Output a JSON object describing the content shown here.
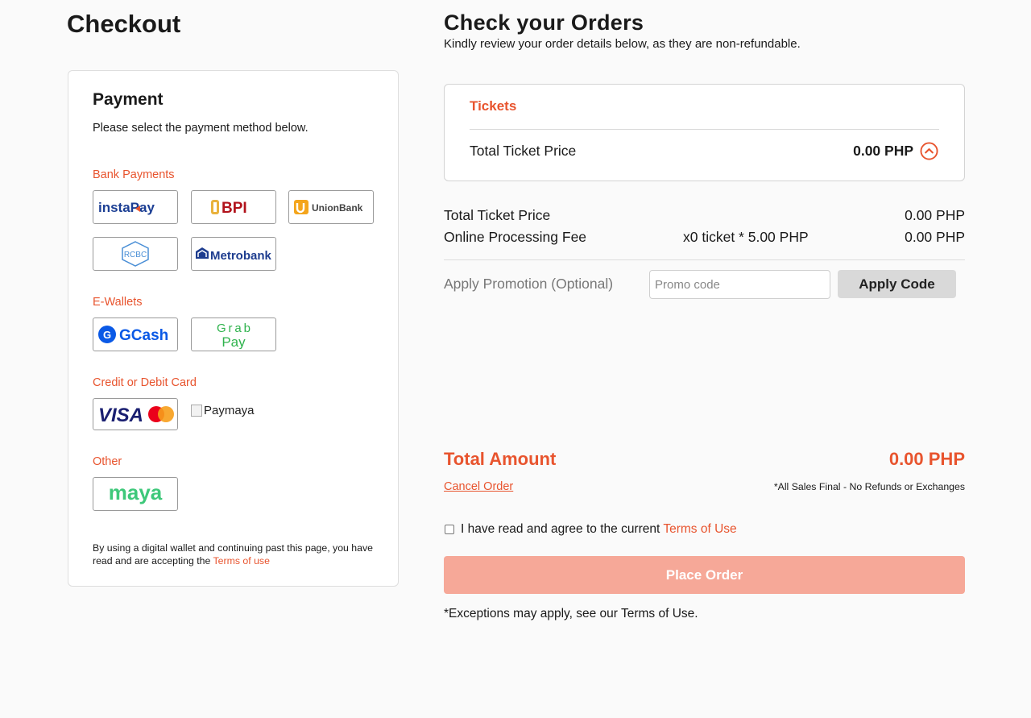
{
  "checkout": {
    "title": "Checkout",
    "payment": {
      "title": "Payment",
      "subtitle": "Please select the payment method below.",
      "sections": {
        "bank": "Bank Payments",
        "ewallets": "E-Wallets",
        "card": "Credit or Debit Card",
        "other": "Other"
      },
      "methods": {
        "instapay": "instaPay",
        "bpi": "BPI",
        "unionbank": "UnionBank",
        "rcbc": "RCBC",
        "metrobank": "Metrobank",
        "gcash": "GCash",
        "grabpay": "GrabPay",
        "visa": "VISA",
        "paymaya": "Paymaya",
        "maya": "maya"
      },
      "disclaimer_text": "By using a digital wallet and continuing past this page, you have read and are accepting the",
      "disclaimer_link": "Terms of use"
    }
  },
  "orders": {
    "title": "Check your Orders",
    "subtitle": "Kindly review your order details below, as they are non-refundable.",
    "tickets_label": "Tickets",
    "ticket_card_total_label": "Total Ticket Price",
    "ticket_card_total_value": "0.00 PHP",
    "summary": {
      "ticket_price_label": "Total Ticket Price",
      "ticket_price_value": "0.00 PHP",
      "fee_label": "Online Processing Fee",
      "fee_detail": "x0 ticket * 5.00 PHP",
      "fee_value": "0.00 PHP"
    },
    "promo": {
      "label": "Apply Promotion (Optional)",
      "placeholder": "Promo code",
      "button": "Apply Code"
    },
    "total_label": "Total Amount",
    "total_value": "0.00 PHP",
    "cancel_label": "Cancel Order",
    "sales_note": "*All Sales Final - No Refunds or Exchanges",
    "agree_text": "I have read and agree to the current",
    "agree_link": "Terms of Use",
    "place_order": "Place Order",
    "exceptions": "*Exceptions may apply, see our Terms of Use."
  },
  "colors": {
    "accent": "#e8542e",
    "place_order_disabled": "#f6a898",
    "maya_green": "#3ec87a",
    "gcash_blue": "#0a59e6",
    "visa_blue": "#1a1f71"
  }
}
